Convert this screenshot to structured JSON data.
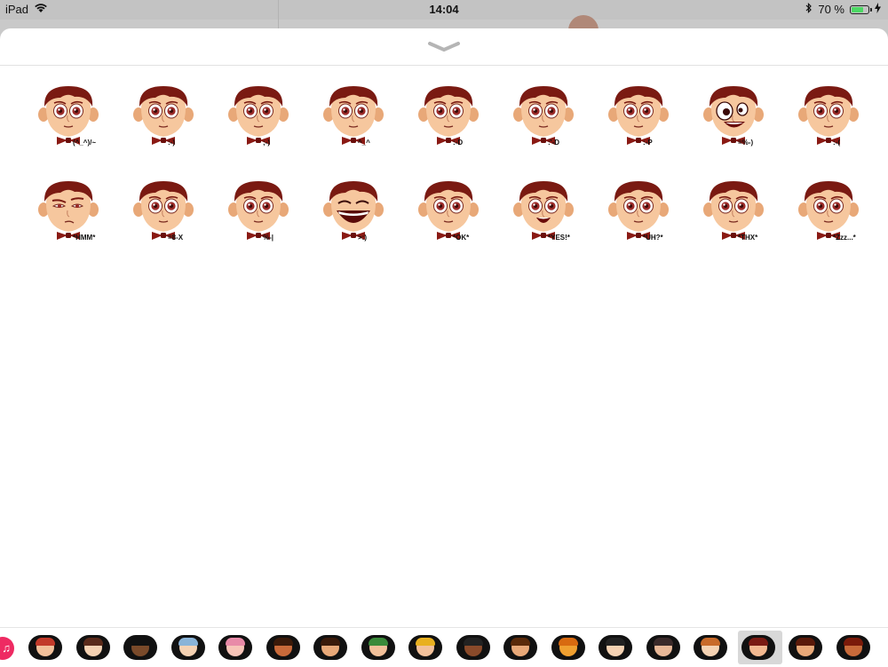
{
  "status_bar": {
    "device": "iPad",
    "time": "14:04",
    "battery_percent_text": "70 %",
    "battery_level": 0.7
  },
  "stickers": [
    {
      "caption": "(^_^)/~",
      "mood": "neutral",
      "hair": "#7a1a12"
    },
    {
      "caption": ":-)",
      "mood": "neutral",
      "hair": "#7a1a12"
    },
    {
      "caption": ";-)",
      "mood": "neutral",
      "hair": "#7a1a12"
    },
    {
      "caption": "^_^",
      "mood": "neutral",
      "hair": "#7a1a12"
    },
    {
      "caption": ":-D",
      "mood": "neutral",
      "hair": "#7a1a12"
    },
    {
      "caption": ":'-D",
      "mood": "neutral",
      "hair": "#7a1a12"
    },
    {
      "caption": ":-P",
      "mood": "neutral",
      "hair": "#7a1a12"
    },
    {
      "caption": "=%-)",
      "mood": "crazy",
      "hair": "#7a1a12"
    },
    {
      "caption": ":-(",
      "mood": "neutral",
      "hair": "#7a1a12"
    },
    {
      "caption": "*HMM*",
      "mood": "skeptical",
      "hair": "#7a1a12"
    },
    {
      "caption": "=8-X",
      "mood": "neutral",
      "hair": "#7a1a12"
    },
    {
      "caption": "%-|",
      "mood": "neutral",
      "hair": "#7a1a12"
    },
    {
      "caption": ">:)",
      "mood": "laugh",
      "hair": "#7a1a12"
    },
    {
      "caption": "*OK*",
      "mood": "neutral",
      "hair": "#7a1a12"
    },
    {
      "caption": "*YES!*",
      "mood": "happy",
      "hair": "#7a1a12"
    },
    {
      "caption": "*UH?*",
      "mood": "neutral",
      "hair": "#7a1a12"
    },
    {
      "caption": "*THX*",
      "mood": "neutral",
      "hair": "#7a1a12"
    },
    {
      "caption": "*Zzz...*",
      "mood": "neutral",
      "hair": "#7a1a12"
    }
  ],
  "drawer_apps": [
    {
      "name": "sticker-pack-1",
      "skin": "#f2c09a",
      "hair": "#c23a2a"
    },
    {
      "name": "sticker-pack-2",
      "skin": "#f5d2b3",
      "hair": "#5a2a1a"
    },
    {
      "name": "sticker-pack-3",
      "skin": "#7a4a2a",
      "hair": "#111111"
    },
    {
      "name": "sticker-pack-4",
      "skin": "#f5d2b3",
      "hair": "#8ab4d8"
    },
    {
      "name": "sticker-pack-5",
      "skin": "#f7c4b8",
      "hair": "#e88aa8"
    },
    {
      "name": "sticker-pack-6",
      "skin": "#c96a3a",
      "hair": "#3a1a0a"
    },
    {
      "name": "sticker-pack-7",
      "skin": "#e8a878",
      "hair": "#3a1a0a"
    },
    {
      "name": "sticker-pack-8",
      "skin": "#f2c09a",
      "hair": "#3a8a3a"
    },
    {
      "name": "sticker-pack-9",
      "skin": "#f2c09a",
      "hair": "#e8b020"
    },
    {
      "name": "sticker-pack-10",
      "skin": "#8a4a2a",
      "hair": "#222222"
    },
    {
      "name": "sticker-pack-11",
      "skin": "#e8a878",
      "hair": "#5a2a0a"
    },
    {
      "name": "sticker-pack-12",
      "skin": "#f0a030",
      "hair": "#d86a10"
    },
    {
      "name": "sticker-pack-13",
      "skin": "#f5d2b3",
      "hair": "#222222"
    },
    {
      "name": "sticker-pack-14",
      "skin": "#e8b898",
      "hair": "#3a2a2a"
    },
    {
      "name": "sticker-pack-15",
      "skin": "#f5d2b3",
      "hair": "#c86a2a"
    },
    {
      "name": "sticker-pack-16",
      "skin": "#f2b890",
      "hair": "#7a1a12"
    },
    {
      "name": "sticker-pack-17",
      "skin": "#e8a878",
      "hair": "#5a1a0a"
    },
    {
      "name": "sticker-pack-18",
      "skin": "#c86a3a",
      "hair": "#7a1a0a"
    }
  ],
  "selected_app_index": 15,
  "colors": {
    "skin": "#f6c79e",
    "skin_shadow": "#e8a878",
    "hair": "#7a1a12",
    "bowtie": "#8a1a14",
    "eye": "#9a2a28",
    "music_app": "#ee2a62"
  }
}
